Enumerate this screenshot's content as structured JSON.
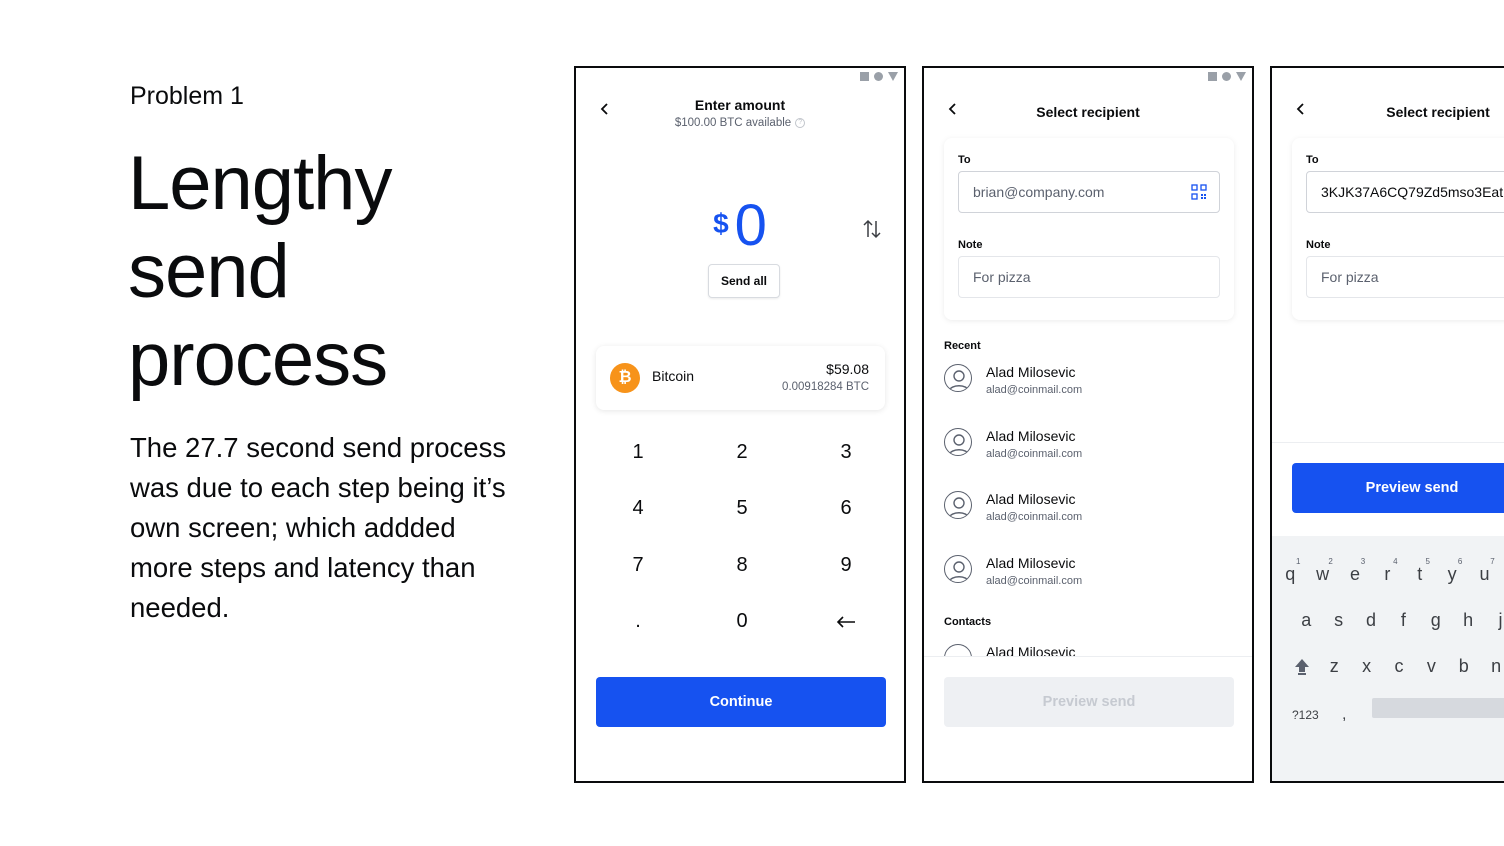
{
  "slide": {
    "eyebrow": "Problem 1",
    "headline": "Lengthy send process",
    "body": "The 27.7 second send process was due to each step being it’s own screen; which addded more steps and latency than needed."
  },
  "screen1": {
    "title": "Enter amount",
    "subtitle": "$100.00 BTC available",
    "info_icon": "?",
    "currency_symbol": "$",
    "amount": "0",
    "send_all_label": "Send all",
    "asset": {
      "icon_symbol": "₿",
      "name": "Bitcoin",
      "usd": "$59.08",
      "btc": "0.00918284 BTC"
    },
    "keypad": [
      "1",
      "2",
      "3",
      "4",
      "5",
      "6",
      "7",
      "8",
      "9",
      ".",
      "0"
    ],
    "continue_label": "Continue"
  },
  "screen2": {
    "title": "Select recipient",
    "to_label": "To",
    "to_value": "brian@company.com",
    "note_label": "Note",
    "note_placeholder": "For pizza",
    "recent_label": "Recent",
    "recent": [
      {
        "name": "Alad Milosevic",
        "email": "alad@coinmail.com"
      },
      {
        "name": "Alad Milosevic",
        "email": "alad@coinmail.com"
      },
      {
        "name": "Alad Milosevic",
        "email": "alad@coinmail.com"
      },
      {
        "name": "Alad Milosevic",
        "email": "alad@coinmail.com"
      }
    ],
    "contacts_label": "Contacts",
    "contact_peek": "Alad Milosevic",
    "preview_label": "Preview send"
  },
  "screen3": {
    "title": "Select recipient",
    "to_label": "To",
    "to_value": "3KJK37A6CQ79Zd5mso3Eat",
    "note_label": "Note",
    "note_placeholder": "For pizza",
    "preview_label": "Preview send",
    "keyboard": {
      "row1": [
        {
          "k": "q",
          "h": "1"
        },
        {
          "k": "w",
          "h": "2"
        },
        {
          "k": "e",
          "h": "3"
        },
        {
          "k": "r",
          "h": "4"
        },
        {
          "k": "t",
          "h": "5"
        },
        {
          "k": "y",
          "h": "6"
        },
        {
          "k": "u",
          "h": "7"
        }
      ],
      "row2": [
        "a",
        "s",
        "d",
        "f",
        "g",
        "h",
        "j"
      ],
      "row3": [
        "z",
        "x",
        "c",
        "v",
        "b",
        "n"
      ],
      "sym_label": "?123",
      "comma": ","
    }
  },
  "colors": {
    "accent": "#1652f0",
    "bitcoin": "#f7931a",
    "muted": "#5b616e"
  }
}
